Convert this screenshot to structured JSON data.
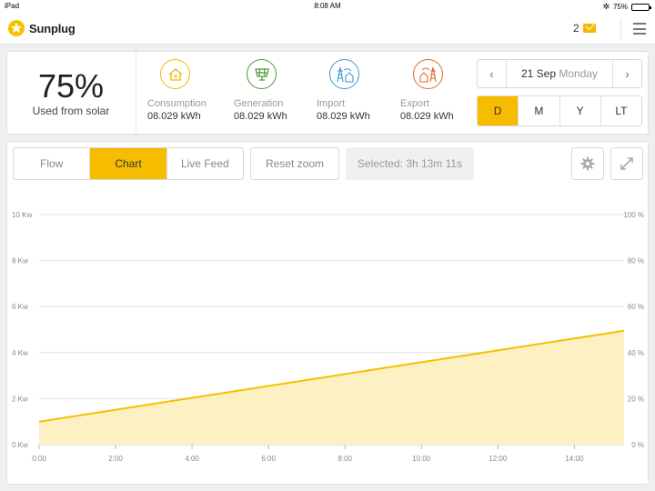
{
  "status": {
    "device": "iPad",
    "time": "8:08 AM",
    "battery": "75%",
    "battery_level": 0.75
  },
  "header": {
    "brand": "Sunplug",
    "message_count": "2"
  },
  "summary": {
    "percent": "75%",
    "percent_label": "Used from solar",
    "metrics": [
      {
        "label": "Consumption",
        "value": "08.029 kWh",
        "color": "#f2b800",
        "icon": "house-icon"
      },
      {
        "label": "Generation",
        "value": "08.029 kWh",
        "color": "#4a9a3a",
        "icon": "solar-panel-icon"
      },
      {
        "label": "Import",
        "value": "08.029 kWh",
        "color": "#3a9ad0",
        "icon": "grid-import-icon"
      },
      {
        "label": "Export",
        "value": "08.029 kWh",
        "color": "#e06a20",
        "icon": "grid-export-icon"
      }
    ],
    "date": {
      "day": "21 Sep",
      "weekday": "Monday"
    },
    "periods": [
      "D",
      "M",
      "Y",
      "LT"
    ],
    "active_period": "D"
  },
  "toolbar": {
    "tabs": [
      "Flow",
      "Chart",
      "Live Feed"
    ],
    "active_tab": "Chart",
    "reset_label": "Reset zoom",
    "selected_label": "Selected: 3h 13m 11s"
  },
  "chart_data": {
    "type": "area",
    "x_ticks": [
      "0:00",
      "2:00",
      "4:00",
      "6:00",
      "8:00",
      "10:00",
      "12:00",
      "14:00"
    ],
    "y_left_ticks": [
      "0 Kw",
      "2 Kw",
      "4 Kw",
      "6 Kw",
      "8 Kw",
      "10 Kw"
    ],
    "y_right_ticks": [
      "0 %",
      "20 %",
      "40 %",
      "60 %",
      "80 %",
      "100 %"
    ],
    "ylim": [
      0,
      10
    ],
    "xlim_hours": [
      0,
      15.3
    ],
    "series": [
      {
        "x": [
          0,
          15.3
        ],
        "y": [
          1.0,
          4.95
        ]
      }
    ],
    "grid": true,
    "line_color": "#f5c000",
    "fill_color": "#fdf0c2"
  }
}
